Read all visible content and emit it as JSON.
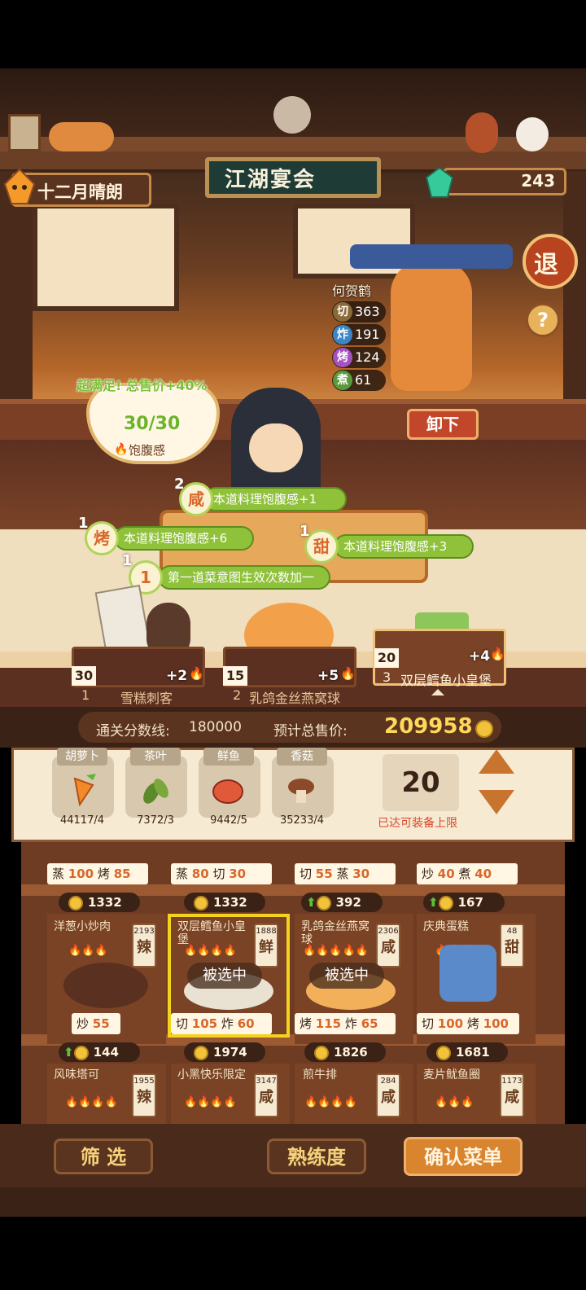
{
  "header": {
    "date_label": "十二月晴朗",
    "sign_title": "江湖宴会",
    "gems": "243",
    "exit_label": "退",
    "help_label": "?"
  },
  "npc": {
    "name": "何贺鹤",
    "stats": [
      {
        "label": "切",
        "value": "363",
        "color": "#8b6a3a"
      },
      {
        "label": "炸",
        "value": "191",
        "color": "#3a86c9"
      },
      {
        "label": "烤",
        "value": "124",
        "color": "#a451c2"
      },
      {
        "label": "煮",
        "value": "61",
        "color": "#5a9a3a"
      }
    ],
    "unload_label": "卸下"
  },
  "satiety": {
    "bonus_text": "超满足!  总售价+40%",
    "value": "30/30",
    "label": "饱腹感"
  },
  "effects": [
    {
      "count": "2",
      "icon": "咸",
      "text": "本道料理饱腹感+1"
    },
    {
      "count": "1",
      "icon": "烤",
      "text": "本道料理饱腹感+6"
    },
    {
      "count": "1",
      "icon": "甜",
      "text": "本道料理饱腹感+3"
    },
    {
      "count": "1",
      "icon": "1",
      "text": "第一道菜意图生效次数加一"
    }
  ],
  "selected_dishes": [
    {
      "index": "1",
      "name": "雪糕刺客",
      "qty": "30",
      "bonus": "+2"
    },
    {
      "index": "2",
      "name": "乳鸽金丝燕窝球",
      "qty": "15",
      "bonus": "+5"
    },
    {
      "index": "3",
      "name": "双层鳕鱼小皇堡",
      "qty": "20",
      "bonus": "+4"
    }
  ],
  "score": {
    "threshold_label": "通关分数线:",
    "threshold_value": "180000",
    "forecast_label": "预计总售价:",
    "forecast_value": "209958"
  },
  "ingredients": [
    {
      "name": "胡萝卜",
      "count": "44117/4",
      "icon": "carrot-icon"
    },
    {
      "name": "茶叶",
      "count": "7372/3",
      "icon": "tea-leaf-icon"
    },
    {
      "name": "鲜鱼",
      "count": "9442/5",
      "icon": "fish-icon"
    },
    {
      "name": "香菇",
      "count": "35233/4",
      "icon": "mushroom-icon"
    }
  ],
  "equip": {
    "count": "20",
    "note": "已达可装备上限"
  },
  "recipe_top_row": [
    {
      "stats": [
        [
          "蒸",
          "100"
        ],
        [
          "烤",
          "85"
        ]
      ],
      "price": "1332",
      "up": false
    },
    {
      "stats": [
        [
          "蒸",
          "80"
        ],
        [
          "切",
          "30"
        ]
      ],
      "price": "1332",
      "up": false
    },
    {
      "stats": [
        [
          "切",
          "55"
        ],
        [
          "蒸",
          "30"
        ]
      ],
      "price": "392",
      "up": true
    },
    {
      "stats": [
        [
          "炒",
          "40"
        ],
        [
          "煮",
          "40"
        ]
      ],
      "price": "167",
      "up": true
    }
  ],
  "recipes_mid": [
    {
      "name": "洋葱小炒肉",
      "fire": "🔥🔥🔥",
      "badge_num": "2193",
      "badge": "辣",
      "stats": [
        [
          "炒",
          "55"
        ]
      ],
      "price": "144",
      "up": true,
      "selected": false
    },
    {
      "name": "双层鳕鱼小皇堡",
      "fire": "🔥🔥🔥🔥",
      "badge_num": "1888",
      "badge": "鲜",
      "stats": [
        [
          "切",
          "105"
        ],
        [
          "炸",
          "60"
        ]
      ],
      "price": "1974",
      "up": false,
      "selected": true,
      "tag": "被选中"
    },
    {
      "name": "乳鸽金丝燕窝球",
      "fire": "🔥🔥🔥🔥🔥",
      "badge_num": "2306",
      "badge": "咸",
      "stats": [
        [
          "烤",
          "115"
        ],
        [
          "炸",
          "65"
        ]
      ],
      "price": "1826",
      "up": false,
      "selected": true,
      "tag": "被选中"
    },
    {
      "name": "庆典蛋糕",
      "fire": "🔥🔥🔥",
      "badge_num": "48",
      "badge": "甜",
      "stats": [
        [
          "切",
          "100"
        ],
        [
          "烤",
          "100"
        ]
      ],
      "price": "1681",
      "up": false,
      "selected": false
    }
  ],
  "recipes_bottom": [
    {
      "name": "风味塔可",
      "fire": "🔥🔥🔥🔥",
      "badge_num": "1955",
      "badge": "辣"
    },
    {
      "name": "小黑快乐限定",
      "fire": "🔥🔥🔥🔥",
      "badge_num": "3147",
      "badge": "咸"
    },
    {
      "name": "煎牛排",
      "fire": "🔥🔥🔥🔥",
      "badge_num": "284",
      "badge": "咸"
    },
    {
      "name": "麦片鱿鱼圈",
      "fire": "🔥🔥🔥",
      "badge_num": "1173",
      "badge": "咸"
    }
  ],
  "buttons": {
    "filter": "筛 选",
    "proficiency": "熟练度",
    "confirm": "确认菜单"
  }
}
